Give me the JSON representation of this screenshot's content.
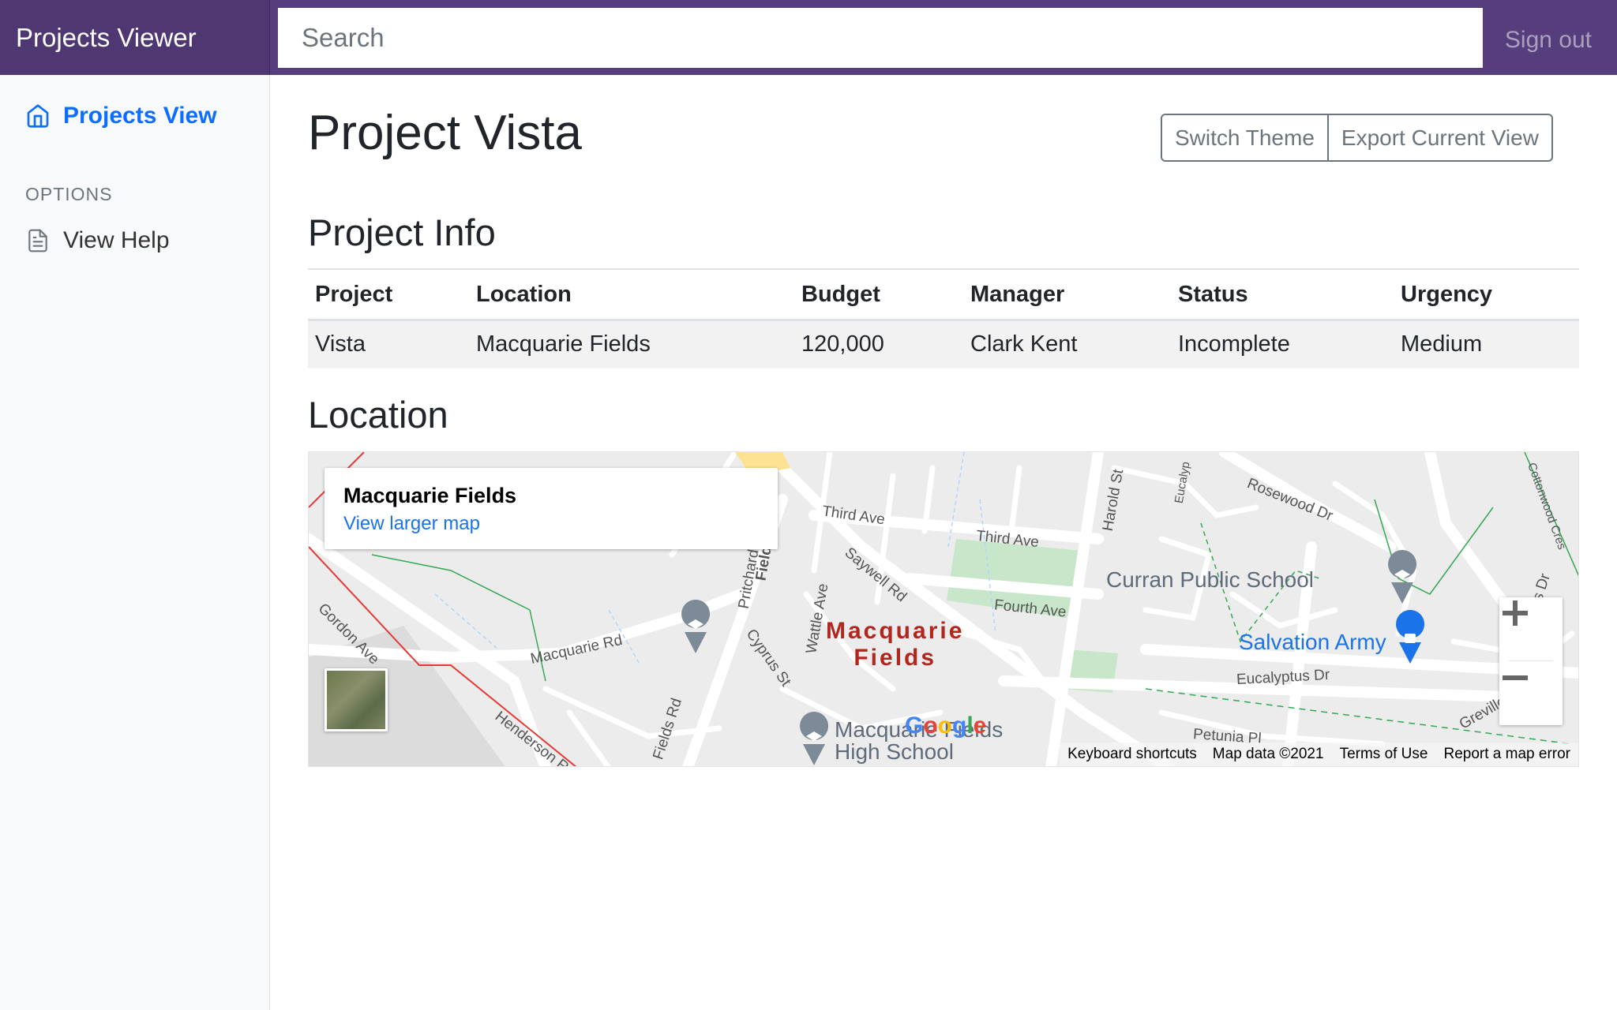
{
  "navbar": {
    "brand": "Projects Viewer",
    "search_placeholder": "Search",
    "signout_label": "Sign out"
  },
  "sidebar": {
    "active_item": "Projects View",
    "options_heading": "OPTIONS",
    "help_item": "View Help"
  },
  "main": {
    "title": "Project Vista",
    "switch_theme_label": "Switch Theme",
    "export_label": "Export Current View",
    "project_info_heading": "Project Info",
    "location_heading": "Location"
  },
  "table": {
    "headers": [
      "Project",
      "Location",
      "Budget",
      "Manager",
      "Status",
      "Urgency"
    ],
    "rows": [
      [
        "Vista",
        "Macquarie Fields",
        "120,000",
        "Clark Kent",
        "Incomplete",
        "Medium"
      ]
    ]
  },
  "map": {
    "info_title": "Macquarie Fields",
    "info_link": "View larger map",
    "suburb_line1": "Macquarie",
    "suburb_line2": "Fields",
    "poi_school": "Curran Public School",
    "poi_army": "Salvation Army",
    "poi_high1": "Macquarie Fields",
    "poi_high2": "High School",
    "street_labels": [
      "Third Ave",
      "Third Ave",
      "Fourth Ave",
      "Saywell Rd",
      "Macquarie Rd",
      "Fields Rd",
      "Henderson Rd",
      "Rosewood Dr",
      "Eucalyptus Dr",
      "Eucalyptus Dr",
      "Harold St",
      "Petunia Pl",
      "Cyprus St",
      "Wattle Ave",
      "Gordon Ave",
      "Greville",
      "Cottonwood Cres",
      "Pritchard",
      "Field",
      "Eucalyp"
    ],
    "footer": [
      "Keyboard shortcuts",
      "Map data ©2021",
      "Terms of Use",
      "Report a map error"
    ],
    "google_logo": "Google",
    "colors": {
      "park": "#c8e6c9",
      "road": "#ffffff",
      "boundary": "#e53935",
      "path": "#34a853",
      "suburb": "#b3261e"
    }
  }
}
